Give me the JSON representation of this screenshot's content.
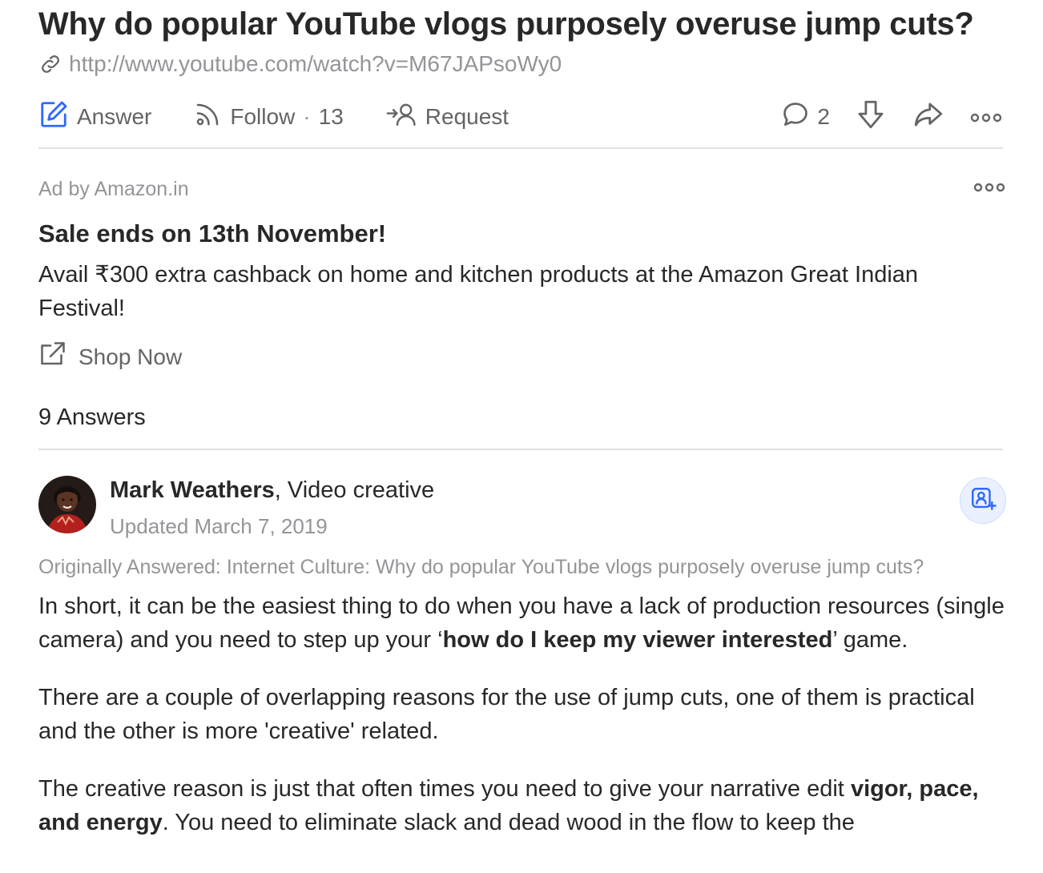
{
  "question": {
    "title": "Why do popular YouTube vlogs purposely overuse jump cuts?",
    "link": "http://www.youtube.com/watch?v=M67JAPsoWy0"
  },
  "actions": {
    "answer_label": "Answer",
    "follow_label": "Follow",
    "follow_sep": "·",
    "follow_count": "13",
    "request_label": "Request",
    "comments_count": "2"
  },
  "ad": {
    "by": "Ad by Amazon.in",
    "headline": "Sale ends on 13th November!",
    "body": "Avail ₹300 extra cashback on home and kitchen products at the Amazon Great Indian Festival!",
    "cta": "Shop Now"
  },
  "answers_count": "9 Answers",
  "answer": {
    "author_name": "Mark Weathers",
    "author_credential": ", Video creative",
    "updated": "Updated March 7, 2019",
    "originally_answered": "Originally Answered: Internet Culture: Why do popular YouTube vlogs purposely overuse jump cuts?",
    "p1_a": "In short, it can be the easiest thing to do when you have a lack of production resources (single camera) and you need to step up your ‘",
    "p1_b": "how do I keep my viewer interested",
    "p1_c": "’ game.",
    "p2": "There are a couple of overlapping reasons for the use of jump cuts, one of them is practical and the other is more 'creative' related.",
    "p3_a": "The creative reason is just that often times you need to give your narrative edit ",
    "p3_b": "vigor, pace, and energy",
    "p3_c": ". You need to eliminate slack and dead wood in the flow to keep the"
  },
  "colors": {
    "accent_blue": "#2e69ff",
    "text": "#282829",
    "muted": "#939598",
    "icon": "#636466",
    "divider": "#dee0e1"
  },
  "icons": [
    "link-icon",
    "pencil-icon",
    "follow-rss-icon",
    "request-person-icon",
    "comment-icon",
    "downvote-icon",
    "share-icon",
    "more-icon",
    "external-link-icon",
    "add-user-icon"
  ]
}
